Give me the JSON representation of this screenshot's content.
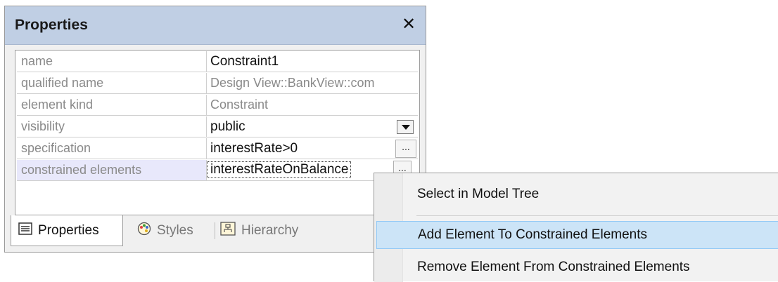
{
  "panel": {
    "title": "Properties",
    "close_glyph": "✕"
  },
  "rows": [
    {
      "name": "name",
      "value": "Constraint1"
    },
    {
      "name": "qualified name",
      "value": "Design View::BankView::com"
    },
    {
      "name": "element kind",
      "value": "Constraint"
    },
    {
      "name": "visibility",
      "value": "public"
    },
    {
      "name": "specification",
      "value": "interestRate>0"
    },
    {
      "name": "constrained elements",
      "value": "interestRateOnBalance"
    }
  ],
  "ellipsis": "...",
  "tabs": [
    {
      "label": "Properties",
      "icon": "properties-icon"
    },
    {
      "label": "Styles",
      "icon": "palette-icon"
    },
    {
      "label": "Hierarchy",
      "icon": "hierarchy-icon"
    }
  ],
  "context_menu": {
    "items": [
      "Select in Model Tree",
      "Add Element To Constrained Elements",
      "Remove Element From Constrained Elements"
    ]
  },
  "colors": {
    "titlebar": "#c0cfe4",
    "menu_highlight": "#cce4f7",
    "selected_row": "#e8e8fb"
  }
}
